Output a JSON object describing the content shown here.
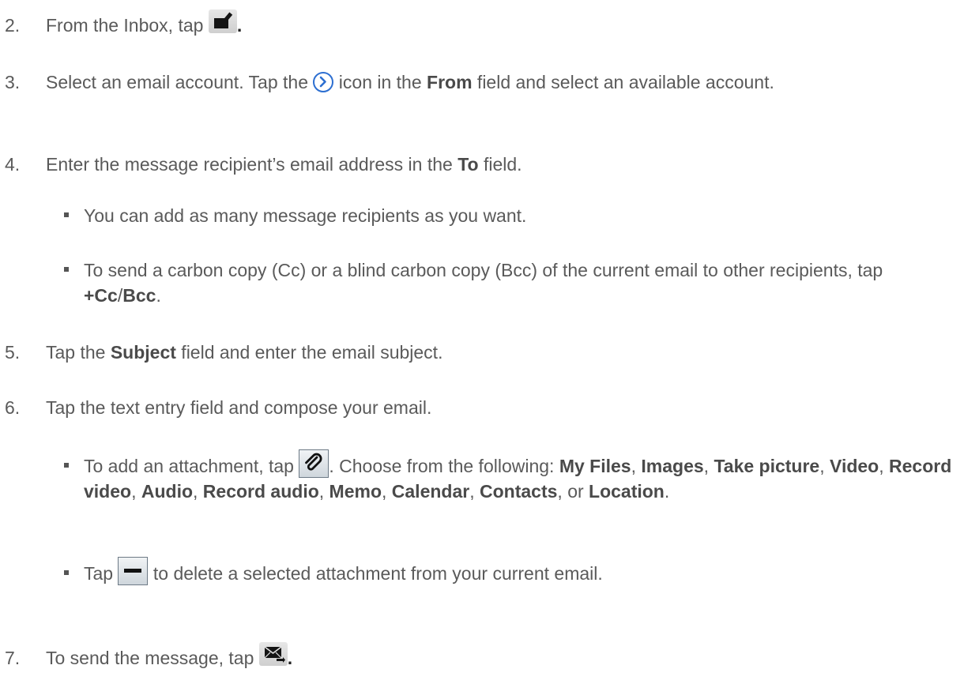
{
  "steps": [
    {
      "number": "2.",
      "before": "From the Inbox, tap",
      "icon": "compose-email-icon",
      "after": "."
    },
    {
      "number": "3.",
      "before": "Select an email account. Tap the",
      "icon": "chevron-circle-right-icon",
      "middle": " icon in the ",
      "bold": "From",
      "after": " field and select an available account."
    },
    {
      "number": "4.",
      "before": "Enter the message recipient’s email address in the ",
      "bold": "To",
      "after": " field."
    },
    {
      "number": "5.",
      "before": "Tap the ",
      "bold": "Subject",
      "after": " field and enter the email subject."
    },
    {
      "number": "6.",
      "before": "Tap the text entry field and compose your email."
    },
    {
      "number": "7.",
      "before": "To send the message, tap",
      "icon": "send-email-icon",
      "after": "."
    }
  ],
  "step4_bullets": [
    {
      "text": "You can add as many message recipients as you want."
    },
    {
      "before": "To send a carbon copy (Cc) or a blind carbon copy (Bcc) of the current email to other recipients, tap ",
      "bold1": "+Cc",
      "sep": "/",
      "bold2": "Bcc",
      "after": "."
    }
  ],
  "step6_bullets": [
    {
      "before": "To add an attachment, tap",
      "icon": "paperclip-icon",
      "middle": ". Choose from the following: ",
      "options": [
        "My Files",
        "Images",
        "Take picture",
        "Video",
        "Record video",
        "Audio",
        "Record audio",
        "Memo",
        "Calendar",
        "Contacts"
      ],
      "or": "or ",
      "last_option": "Location",
      "after": "."
    },
    {
      "before": "Tap",
      "icon": "minus-icon",
      "after": " to delete a selected attachment from your current email."
    }
  ]
}
